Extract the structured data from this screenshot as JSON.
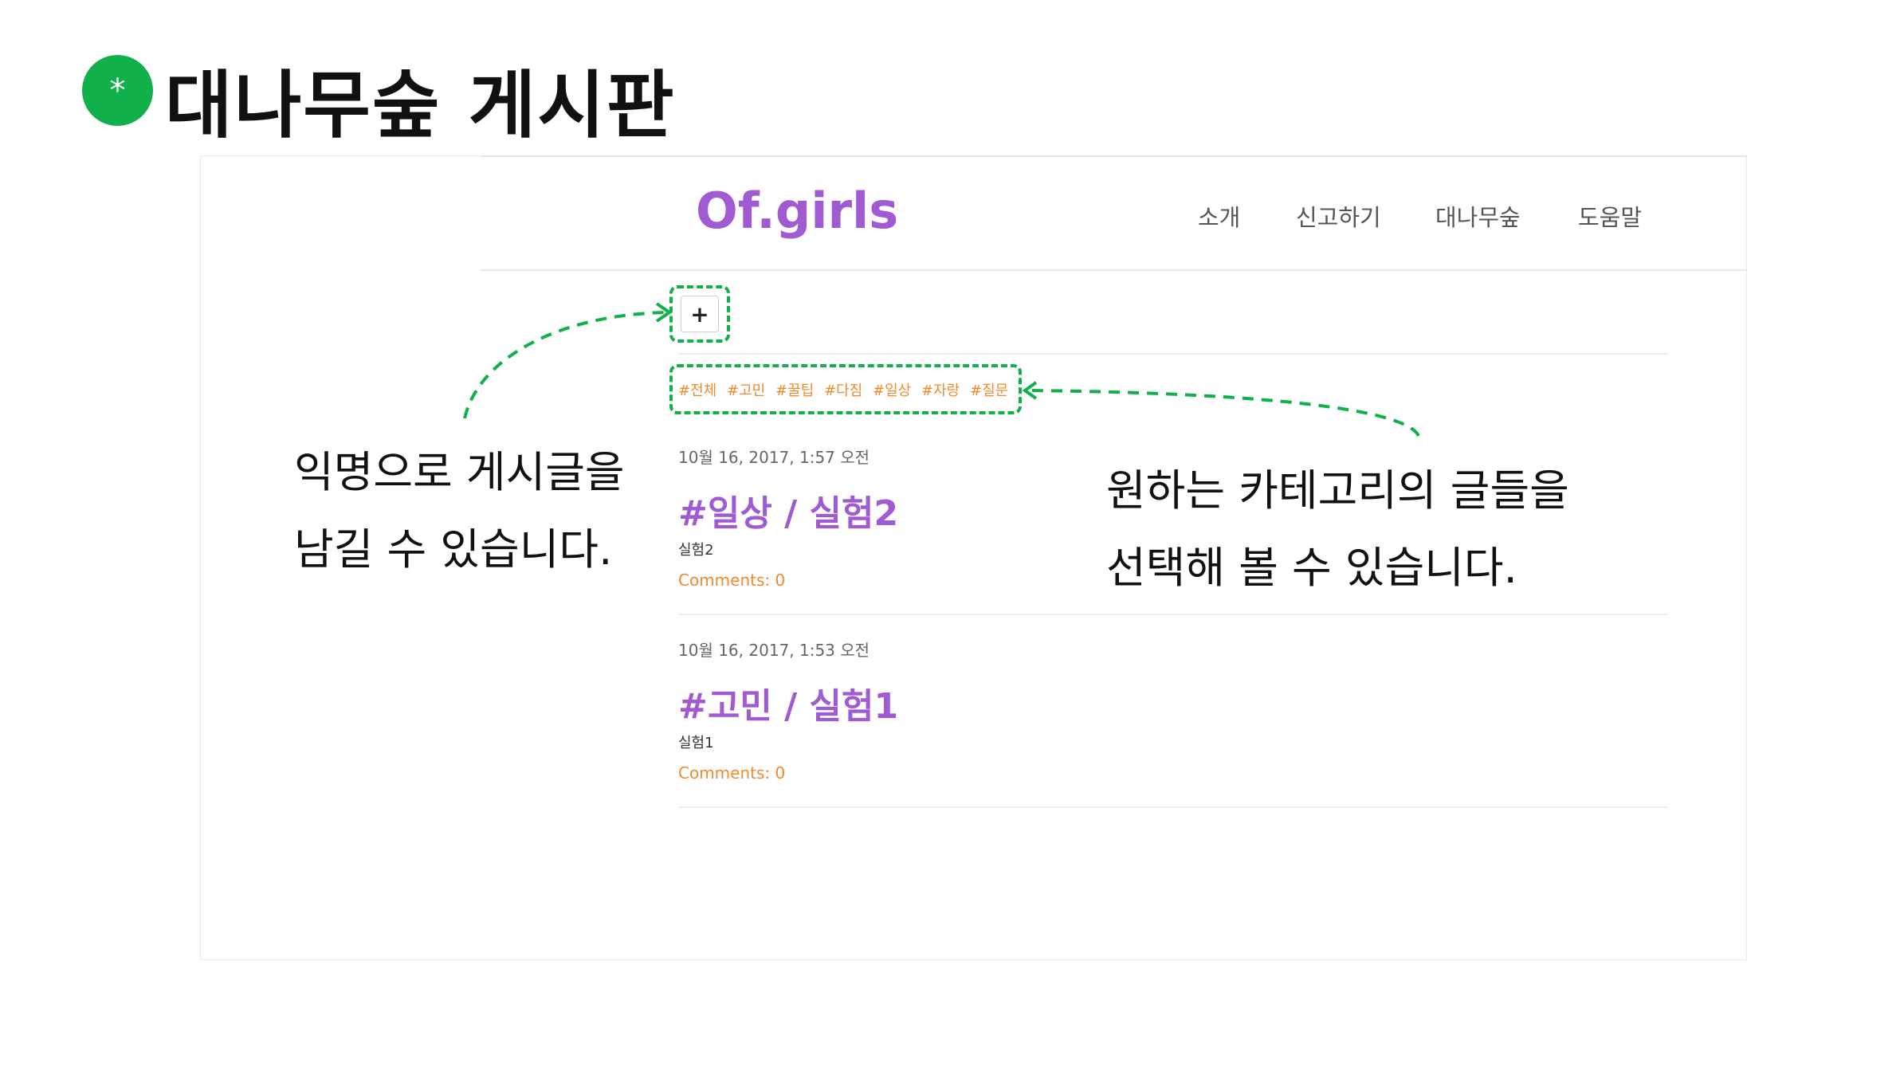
{
  "slide": {
    "marker": "*",
    "title": "대나무숲 게시판"
  },
  "site": {
    "brand": "Of.girls",
    "nav": [
      "소개",
      "신고하기",
      "대나무숲",
      "도움말"
    ],
    "add_label": "+",
    "tags": [
      "#전체",
      "#고민",
      "#꿀팁",
      "#다짐",
      "#일상",
      "#자랑",
      "#질문"
    ]
  },
  "posts": [
    {
      "date": "10월 16, 2017, 1:57 오전",
      "title": "#일상 / 실험2",
      "body": "실험2",
      "comments": "Comments: 0"
    },
    {
      "date": "10월 16, 2017, 1:53 오전",
      "title": "#고민 / 실험1",
      "body": "실험1",
      "comments": "Comments: 0"
    }
  ],
  "callouts": {
    "left": [
      "익명으로 게시글을",
      "남길 수 있습니다."
    ],
    "right": [
      "원하는 카테고리의 글들을",
      "선택해 볼 수 있습니다."
    ]
  },
  "colors": {
    "accent_green": "#12b04a",
    "brand_purple": "#a05ad2",
    "tag_orange": "#f08a2e"
  }
}
